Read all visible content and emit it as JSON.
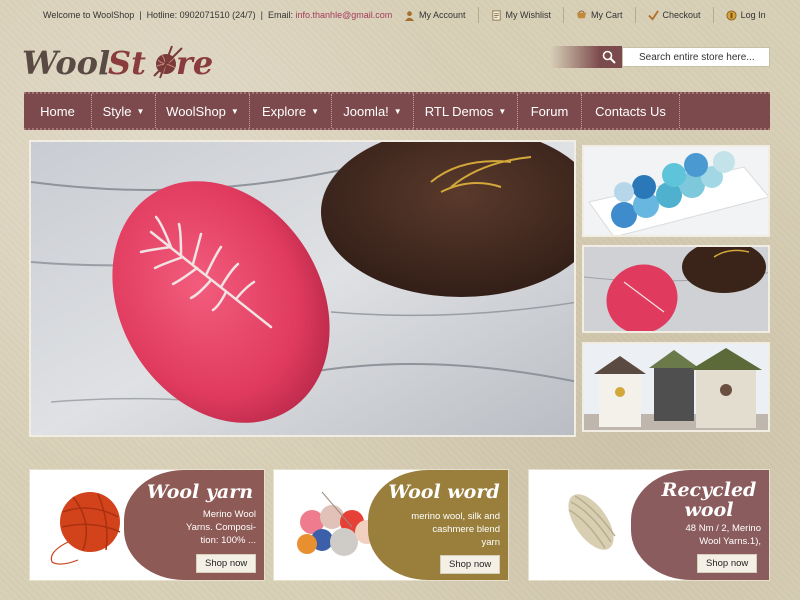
{
  "topbar": {
    "welcome": "Welcome to WoolShop",
    "hotline": "Hotline: 0902071510 (24/7)",
    "email_label": "Email:",
    "email": "info.thanhle@gmail.com",
    "links": [
      {
        "label": "My Account",
        "icon": "user-icon"
      },
      {
        "label": "My Wishlist",
        "icon": "wishlist-icon"
      },
      {
        "label": "My Cart",
        "icon": "cart-icon"
      },
      {
        "label": "Checkout",
        "icon": "checkout-icon"
      },
      {
        "label": "Log In",
        "icon": "login-icon"
      }
    ]
  },
  "logo": {
    "text_left": "Wool",
    "text_mid": "St",
    "text_right": "re"
  },
  "search": {
    "placeholder": "Search entire store here..."
  },
  "nav": {
    "items": [
      {
        "label": "Home",
        "dropdown": false
      },
      {
        "label": "Style",
        "dropdown": true
      },
      {
        "label": "WoolShop",
        "dropdown": true
      },
      {
        "label": "Explore",
        "dropdown": true
      },
      {
        "label": "Joomla!",
        "dropdown": true
      },
      {
        "label": "RTL Demos",
        "dropdown": true
      },
      {
        "label": "Forum",
        "dropdown": false
      },
      {
        "label": "Contacts Us",
        "dropdown": false
      }
    ]
  },
  "cards": [
    {
      "title": "Wool yarn",
      "desc_lines": [
        "Merino Wool",
        "Yarns. Composi-",
        "tion: 100% ..."
      ],
      "button": "Shop now",
      "color": "#8e5a55"
    },
    {
      "title": "Wool word",
      "desc_lines": [
        "merino wool, silk and",
        "cashmere blend",
        "yarn"
      ],
      "button": "Shop now",
      "color": "#9a7f3c"
    },
    {
      "title_lines": [
        "Recycled",
        "wool"
      ],
      "desc_lines": [
        "48 Nm / 2, Merino",
        "Wool Yarns.1),"
      ],
      "button": "Shop now",
      "color": "#8b5c5d"
    }
  ],
  "colors": {
    "nav": "#7c4a4d",
    "accent_pink": "#e04a6a",
    "background": "#d9d0b8"
  }
}
